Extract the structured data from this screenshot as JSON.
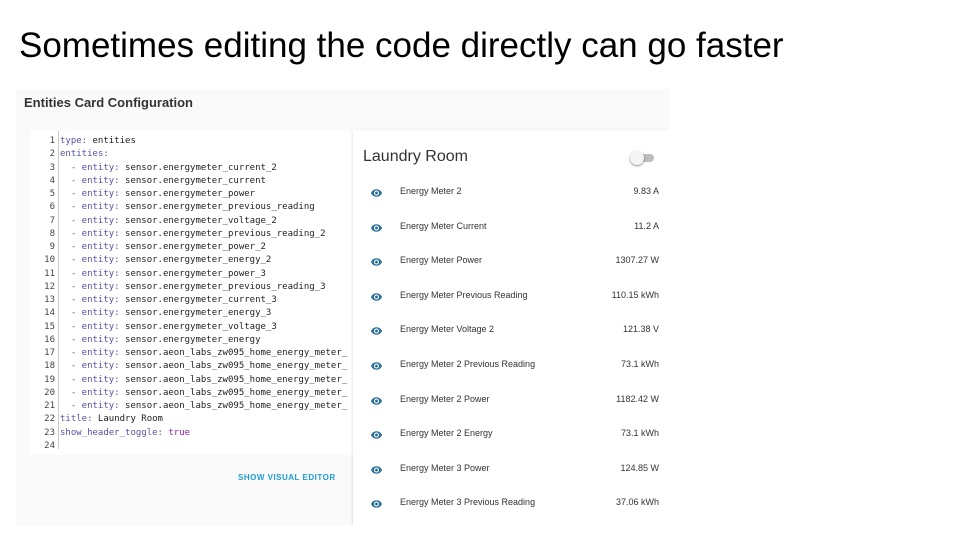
{
  "slide": {
    "title": "Sometimes editing the code directly can go faster"
  },
  "dialog": {
    "title": "Entities Card Configuration",
    "show_visual_editor": "SHOW VISUAL EDITOR"
  },
  "editor": {
    "lines": [
      {
        "n": "1",
        "k": "type:",
        "v": " entities"
      },
      {
        "n": "2",
        "k": "entities:",
        "v": ""
      },
      {
        "n": "3",
        "k": "  - entity:",
        "v": " sensor.energymeter_current_2"
      },
      {
        "n": "4",
        "k": "  - entity:",
        "v": " sensor.energymeter_current"
      },
      {
        "n": "5",
        "k": "  - entity:",
        "v": " sensor.energymeter_power"
      },
      {
        "n": "6",
        "k": "  - entity:",
        "v": " sensor.energymeter_previous_reading"
      },
      {
        "n": "7",
        "k": "  - entity:",
        "v": " sensor.energymeter_voltage_2"
      },
      {
        "n": "8",
        "k": "  - entity:",
        "v": " sensor.energymeter_previous_reading_2"
      },
      {
        "n": "9",
        "k": "  - entity:",
        "v": " sensor.energymeter_power_2"
      },
      {
        "n": "10",
        "k": "  - entity:",
        "v": " sensor.energymeter_energy_2"
      },
      {
        "n": "11",
        "k": "  - entity:",
        "v": " sensor.energymeter_power_3"
      },
      {
        "n": "12",
        "k": "  - entity:",
        "v": " sensor.energymeter_previous_reading_3"
      },
      {
        "n": "13",
        "k": "  - entity:",
        "v": " sensor.energymeter_current_3"
      },
      {
        "n": "14",
        "k": "  - entity:",
        "v": " sensor.energymeter_energy_3"
      },
      {
        "n": "15",
        "k": "  - entity:",
        "v": " sensor.energymeter_voltage_3"
      },
      {
        "n": "16",
        "k": "  - entity:",
        "v": " sensor.energymeter_energy"
      },
      {
        "n": "17",
        "k": "  - entity:",
        "v": " sensor.aeon_labs_zw095_home_energy_meter_"
      },
      {
        "n": "18",
        "k": "  - entity:",
        "v": " sensor.aeon_labs_zw095_home_energy_meter_"
      },
      {
        "n": "19",
        "k": "  - entity:",
        "v": " sensor.aeon_labs_zw095_home_energy_meter_"
      },
      {
        "n": "20",
        "k": "  - entity:",
        "v": " sensor.aeon_labs_zw095_home_energy_meter_"
      },
      {
        "n": "21",
        "k": "  - entity:",
        "v": " sensor.aeon_labs_zw095_home_energy_meter_"
      },
      {
        "n": "22",
        "k": "title:",
        "v": " Laundry Room"
      },
      {
        "n": "23",
        "k": "show_header_toggle:",
        "v": " true"
      },
      {
        "n": "24",
        "k": "",
        "v": ""
      }
    ]
  },
  "card": {
    "title": "Laundry Room",
    "icon": "eye-icon",
    "toggle_on": false,
    "rows": [
      {
        "name": "Energy Meter 2",
        "value": "9.83 A"
      },
      {
        "name": "Energy Meter Current",
        "value": "11.2 A"
      },
      {
        "name": "Energy Meter Power",
        "value": "1307.27 W"
      },
      {
        "name": "Energy Meter Previous Reading",
        "value": "110.15 kWh"
      },
      {
        "name": "Energy Meter Voltage 2",
        "value": "121.38 V"
      },
      {
        "name": "Energy Meter 2 Previous Reading",
        "value": "73.1 kWh"
      },
      {
        "name": "Energy Meter 2 Power",
        "value": "1182.42 W"
      },
      {
        "name": "Energy Meter 2 Energy",
        "value": "73.1 kWh"
      },
      {
        "name": "Energy Meter 3 Power",
        "value": "124.85 W"
      },
      {
        "name": "Energy Meter 3 Previous Reading",
        "value": "37.06 kWh"
      }
    ]
  },
  "colors": {
    "accent": "#1e9bd7",
    "icon": "#2b6f99",
    "yaml_key": "#5552a8",
    "true_value": "#8e24aa"
  }
}
